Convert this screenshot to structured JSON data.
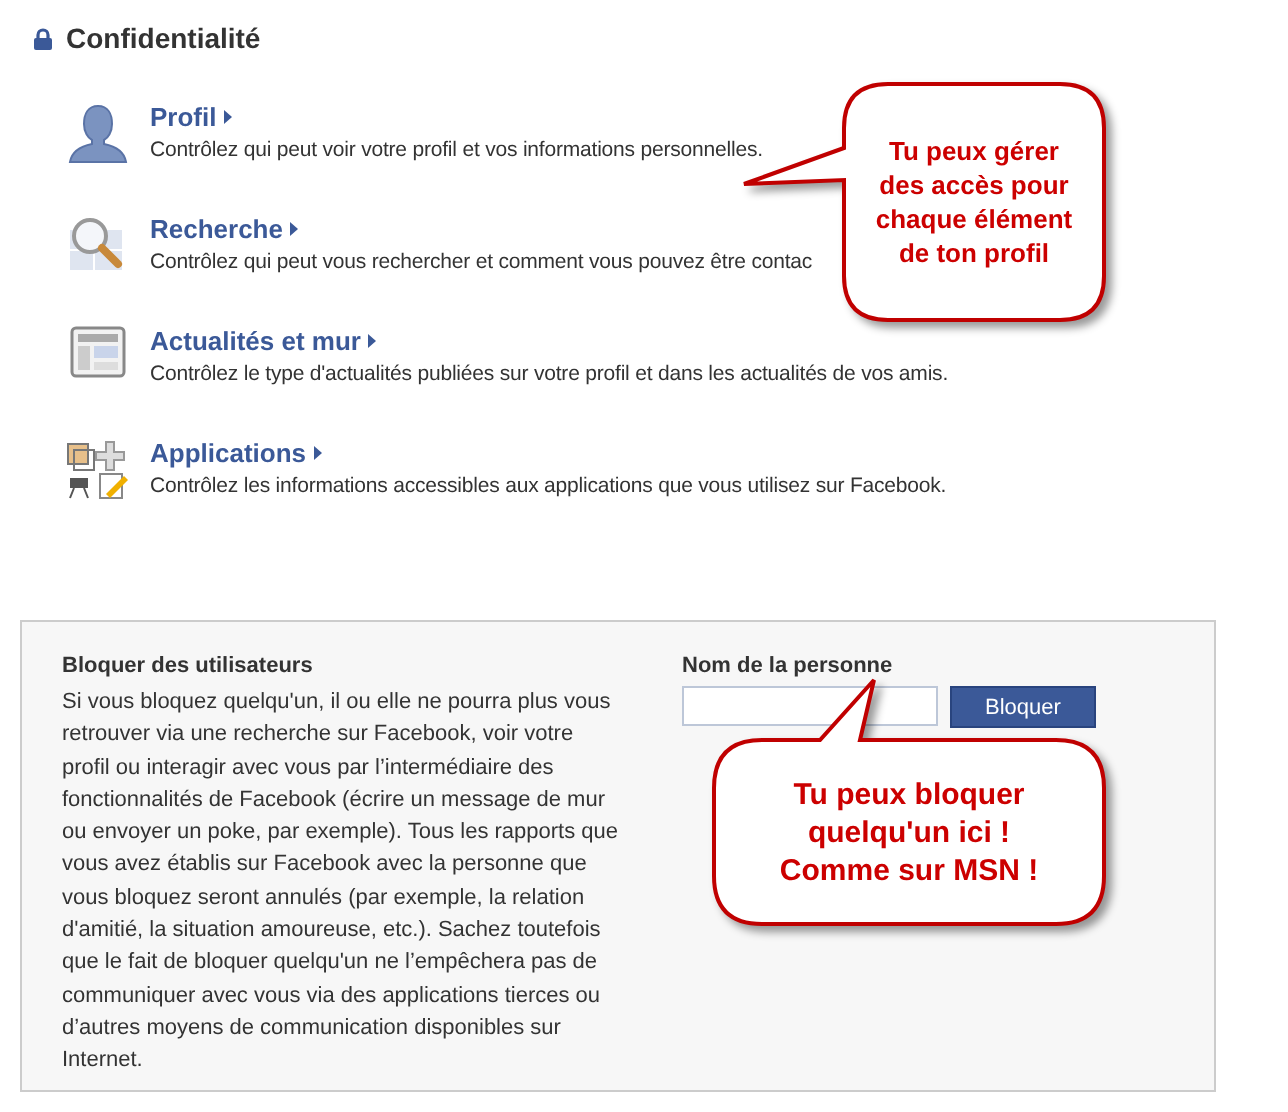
{
  "section": {
    "title": "Confidentialité"
  },
  "items": [
    {
      "kind": "profile",
      "title": "Profil",
      "description": "Contrôlez qui peut voir votre profil et vos informations personnelles."
    },
    {
      "kind": "search",
      "title": "Recherche",
      "description": "Contrôlez qui peut vous rechercher et comment vous pouvez être contac"
    },
    {
      "kind": "news",
      "title": "Actualités et mur",
      "description": "Contrôlez le type d'actualités publiées sur votre profil et dans les actualités de vos amis."
    },
    {
      "kind": "apps",
      "title": "Applications",
      "description": "Contrôlez les informations accessibles aux applications que vous utilisez sur Facebook."
    }
  ],
  "block": {
    "heading": "Bloquer des utilisateurs",
    "text": "Si vous bloquez quelqu'un, il ou elle ne pourra plus vous retrouver via une recherche sur Facebook, voir votre profil ou interagir avec vous par l’intermédiaire des fonctionnalités de Facebook (écrire un message de mur ou envoyer un poke, par exemple). Tous les rapports que vous avez établis sur Facebook avec la personne que vous bloquez seront annulés (par exemple, la relation d'amitié, la situation amoureuse, etc.). Sachez toutefois que le fait de bloquer quelqu'un ne l’empêchera pas de communiquer avec vous via des applications tierces ou d’autres moyens de communication disponibles sur Internet.",
    "field_label": "Nom de la personne",
    "button": "Bloquer"
  },
  "callouts": [
    {
      "text": "Tu peux gérer\ndes accès pour\nchaque élément\nde ton profil"
    },
    {
      "text": "Tu peux bloquer\nquelqu'un ici !\nComme sur MSN !"
    }
  ]
}
